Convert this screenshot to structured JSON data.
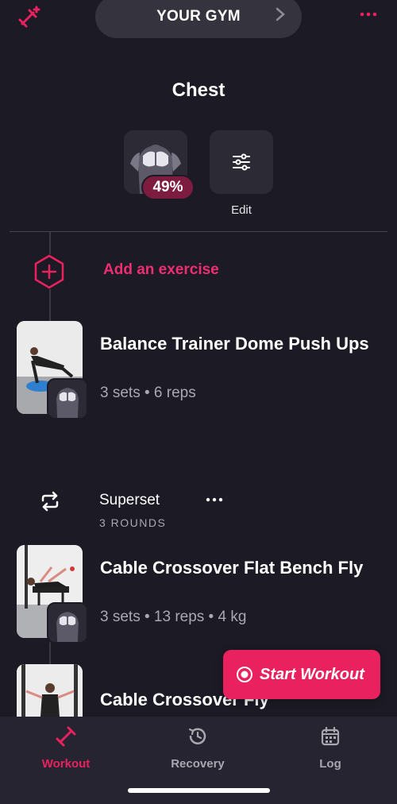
{
  "header": {
    "gym_name": "YOUR GYM"
  },
  "page": {
    "title": "Chest"
  },
  "muscle_summary": {
    "percent_label": "49%",
    "edit_label": "Edit"
  },
  "add_exercise": {
    "label": "Add an exercise"
  },
  "exercises": [
    {
      "name": "Balance Trainer Dome Push Ups",
      "details": "3 sets • 6 reps"
    }
  ],
  "superset": {
    "label": "Superset",
    "rounds": "3 ROUNDS",
    "exercises": [
      {
        "name": "Cable Crossover Flat Bench Fly",
        "details": "3 sets • 13 reps • 4 kg"
      },
      {
        "name": "Cable Crossover Fly",
        "details": ""
      }
    ]
  },
  "start_button": {
    "label": "Start Workout"
  },
  "tabs": [
    {
      "label": "Workout",
      "icon": "dumbbell-icon",
      "active": true
    },
    {
      "label": "Recovery",
      "icon": "recovery-clock-icon",
      "active": false
    },
    {
      "label": "Log",
      "icon": "calendar-icon",
      "active": false
    }
  ],
  "colors": {
    "background": "#1c1a24",
    "accent": "#e9225f",
    "badge": "#7d1c3f",
    "card": "#2c2a35",
    "tabbar": "#262430",
    "muted_text": "#a9a7b0"
  }
}
